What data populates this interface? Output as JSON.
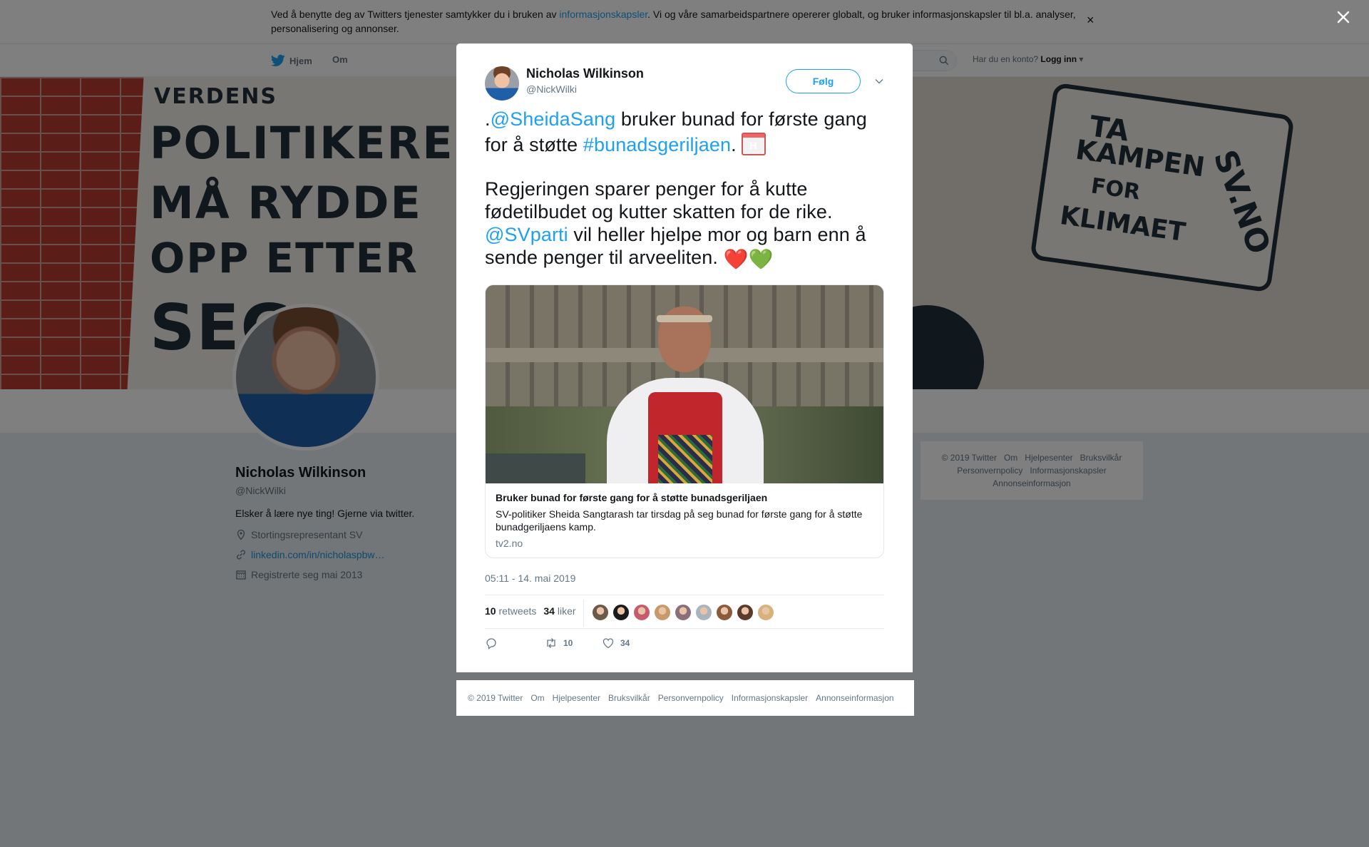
{
  "cookie": {
    "text_before": "Ved å benytte deg av Twitters tjenester samtykker du i bruken av ",
    "link": "informasjonskapsler",
    "text_after": ". Vi og våre samarbeidspartnere opererer globalt, og bruker informasjonskapsler til bl.a. analyser, personalisering og annonser.",
    "close": "×"
  },
  "nav": {
    "home": "Hjem",
    "about": "Om",
    "login_prompt": "Har du en konto?",
    "login": "Logg inn"
  },
  "profile": {
    "name": "Nicholas Wilkinson",
    "handle": "@NickWilki",
    "bio": "Elsker å lære nye ting! Gjerne via twitter.",
    "location": "Stortingsrepresentant SV",
    "url": "linkedin.com/in/nicholaspbw…",
    "joined": "Registrerte seg mai 2013"
  },
  "banner": {
    "left_lines": [
      "VERDENS",
      "POLITIKERE",
      "MÅ RYDDE",
      "OPP ETTER",
      "SEG"
    ],
    "right_lines": [
      "TA",
      "KAMPEN",
      "FOR",
      "KLIMAET",
      "SV.NO"
    ]
  },
  "sidebar_footer": [
    "© 2019 Twitter",
    "Om",
    "Hjelpesenter",
    "Bruksvilkår",
    "Personvernpolicy",
    "Informasjonskapsler",
    "Annonseinformasjon"
  ],
  "tweet": {
    "author_name": "Nicholas Wilkinson",
    "author_handle": "@NickWilki",
    "follow": "Følg",
    "text": {
      "p1_dot": ".",
      "mention1": "@SheidaSang",
      "p1_mid": " bruker bunad for første gang for å støtte ",
      "hashtag": "#bunadsgeriljaen",
      "p1_end": ". ",
      "p2_start": "Regjeringen sparer penger for å kutte fødetilbudet og kutter skatten for de rike. ",
      "mention2": "@SVparti",
      "p2_end": " vil heller hjelpe mor og barn enn å sende penger til arveeliten. ",
      "hearts": [
        "❤️",
        "💚"
      ]
    },
    "card": {
      "title": "Bruker bunad for første gang for å støtte bunadsgeriljaen",
      "description": "SV-politiker Sheida Sangtarash tar tirsdag på seg bunad for første gang for å støtte bunadgeriljaens kamp.",
      "domain": "tv2.no"
    },
    "timestamp": "05:11 - 14. mai 2019",
    "retweets_count": "10",
    "retweets_label": "retweets",
    "likes_count": "34",
    "likes_label": "liker",
    "liker_colors": [
      "#6b5a4a",
      "#1b1b1b",
      "#c85a6e",
      "#c89a6a",
      "#8a6f7a",
      "#aab4bd",
      "#8a5a3a",
      "#5a3b2a",
      "#d8b27a"
    ],
    "actions": {
      "reply_count": "",
      "retweet_count": "10",
      "like_count": "34"
    }
  },
  "footer": [
    "© 2019 Twitter",
    "Om",
    "Hjelpesenter",
    "Bruksvilkår",
    "Personvernpolicy",
    "Informasjonskapsler",
    "Annonseinformasjon"
  ],
  "colors": {
    "accent": "#1da1f2",
    "text": "#14171a",
    "muted": "#657786"
  }
}
